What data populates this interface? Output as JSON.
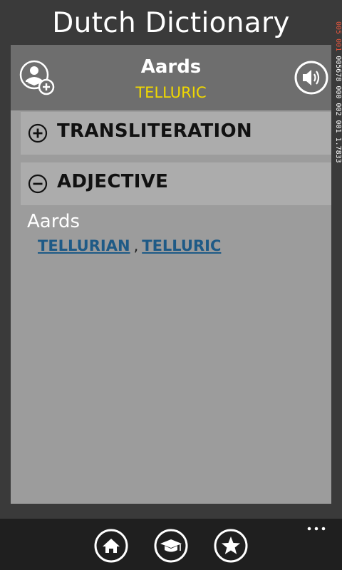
{
  "app": {
    "title": "Dutch Dictionary"
  },
  "word": {
    "term": "Aards",
    "translation": "TELLURIC",
    "add_icon": "add-to-learning-icon",
    "sound_icon": "speaker-icon"
  },
  "sections": [
    {
      "label": "TRANSLITERATION",
      "icon": "expand-plus-icon",
      "expanded": false
    },
    {
      "label": "ADJECTIVE",
      "icon": "collapse-minus-icon",
      "expanded": true
    }
  ],
  "entry": {
    "word": "Aards",
    "translations": [
      "TELLURIAN",
      "TELLURIC"
    ],
    "separator": ","
  },
  "status_bar": {
    "red_text": "005 001",
    "white_text": "005678 000 002 001 1.7833"
  },
  "app_bar": {
    "buttons": [
      {
        "name": "home",
        "icon": "home-icon"
      },
      {
        "name": "learn",
        "icon": "graduation-cap-icon"
      },
      {
        "name": "favorites",
        "icon": "star-icon"
      }
    ],
    "more": "more-options-icon"
  },
  "colors": {
    "background": "#3a3a3a",
    "panel": "#9c9c9c",
    "header": "#6e6e6e",
    "section": "#acacac",
    "accent_yellow": "#f0d800",
    "link": "#1e5a86",
    "app_bar": "#1f1f1f"
  }
}
